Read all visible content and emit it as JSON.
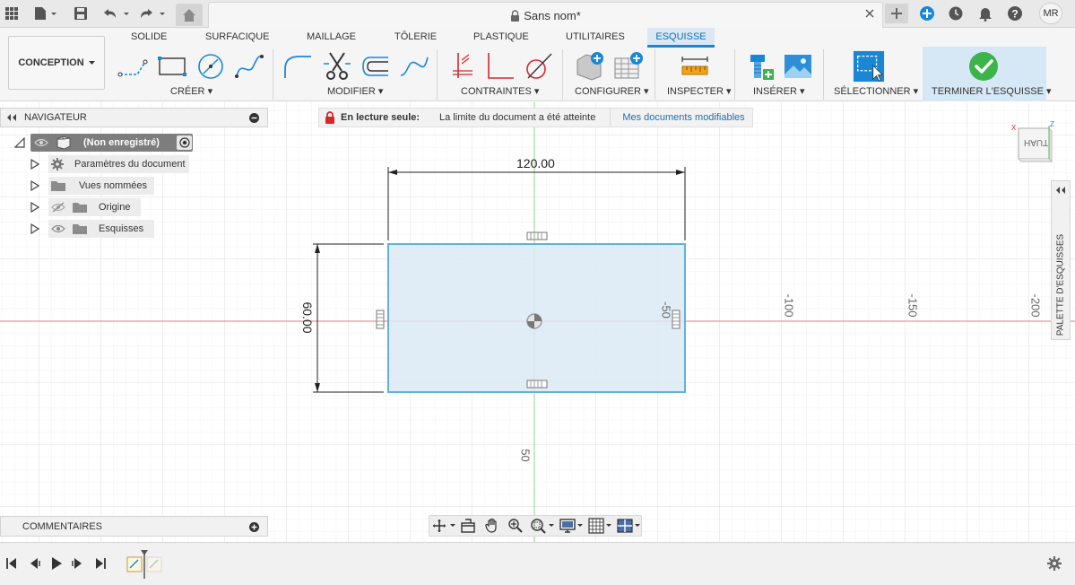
{
  "titlebar": {
    "document_title": "Sans nom*",
    "user_initials": "MR"
  },
  "ribbon": {
    "workspace_label": "CONCEPTION",
    "tabs": [
      "SOLIDE",
      "SURFACIQUE",
      "MAILLAGE",
      "TÔLERIE",
      "PLASTIQUE",
      "UTILITAIRES",
      "ESQUISSE"
    ],
    "active_tab": "ESQUISSE",
    "groups": [
      "CRÉER",
      "MODIFIER",
      "CONTRAINTES",
      "CONFIGURER",
      "INSPECTER",
      "INSÉRER",
      "SÉLECTIONNER",
      "TERMINER L'ESQUISSE"
    ]
  },
  "navigator": {
    "title": "NAVIGATEUR",
    "root": "(Non enregistré)",
    "items": [
      {
        "label": "Paramètres du document",
        "icon": "gear-icon"
      },
      {
        "label": "Vues nommées",
        "icon": "folder-icon"
      },
      {
        "label": "Origine",
        "icon": "folder-icon"
      },
      {
        "label": "Esquisses",
        "icon": "folder-icon"
      }
    ]
  },
  "banner": {
    "label": "En lecture seule:",
    "message": "La limite du document a été atteinte",
    "link": "Mes documents modifiables"
  },
  "sketch": {
    "width_dimension": "120.00",
    "height_dimension": "60.00",
    "axis_labels": [
      "-50",
      "-100",
      "-150",
      "-200",
      "50"
    ]
  },
  "viewcube": {
    "face": "HAUT",
    "axis_x": "X",
    "axis_z": "Z"
  },
  "palette": {
    "label": "PALETTE D'ESQUISSES"
  },
  "comments": {
    "title": "COMMENTAIRES"
  },
  "colors": {
    "accent": "#1a87d6",
    "finish_check": "#3bb54a",
    "sketch_fill": "#dbeaf5",
    "sketch_stroke": "#63b0dc",
    "axis_red": "#e87777",
    "axis_green": "#8ad98a",
    "lock_red": "#d9262b"
  }
}
